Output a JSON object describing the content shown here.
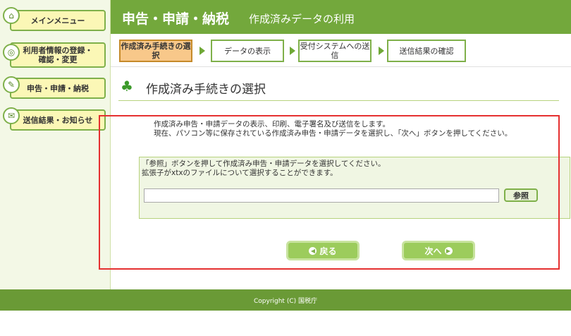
{
  "sidebar": {
    "items": [
      {
        "label": "メインメニュー"
      },
      {
        "label": "利用者情報の登録・\n確認・変更"
      },
      {
        "label": "申告・申請・納税"
      },
      {
        "label": "送信結果・お知らせ"
      }
    ]
  },
  "header": {
    "main": "申告・申請・納税",
    "sub": "作成済みデータの利用"
  },
  "steps": [
    {
      "label": "作成済み手続きの選択",
      "active": true
    },
    {
      "label": "データの表示"
    },
    {
      "label": "受付システムへの送信"
    },
    {
      "label": "送信結果の確認"
    }
  ],
  "section": {
    "title": "作成済み手続きの選択"
  },
  "intro": {
    "line1": "作成済み申告・申請データの表示、印刷、電子署名及び送信をします。",
    "line2": "現在、パソコン等に保存されている作成済み申告・申請データを選択し、「次へ」ボタンを押してください。"
  },
  "file": {
    "instr1": "「参照」ボタンを押して作成済み申告・申請データを選択してください。",
    "instr2": "拡張子がxtxのファイルについて選択することができます。",
    "value": "",
    "browse_label": "参照"
  },
  "nav": {
    "back_label": "戻る",
    "next_label": "次へ"
  },
  "footer": {
    "copyright": "Copyright (C) 国税庁"
  },
  "colors": {
    "accent": "#73a83c",
    "highlight": "#e53030"
  }
}
